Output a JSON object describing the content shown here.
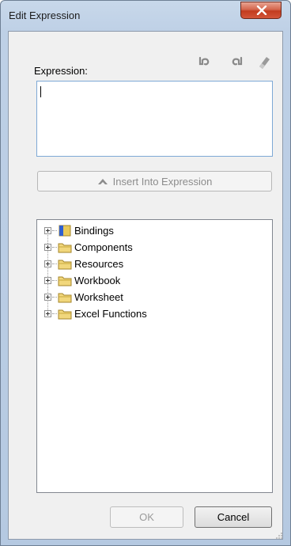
{
  "window": {
    "title": "Edit Expression"
  },
  "expression": {
    "label": "Expression:",
    "value": ""
  },
  "toolbar": {
    "undo_icon": "undo-icon",
    "redo_icon": "redo-icon",
    "clear_icon": "eraser-icon"
  },
  "insert_button": {
    "label": "Insert Into Expression"
  },
  "tree": {
    "items": [
      {
        "label": "Bindings",
        "icon": "bindings-folder-icon"
      },
      {
        "label": "Components",
        "icon": "folder-icon"
      },
      {
        "label": "Resources",
        "icon": "folder-icon"
      },
      {
        "label": "Workbook",
        "icon": "folder-icon"
      },
      {
        "label": "Worksheet",
        "icon": "folder-icon"
      },
      {
        "label": "Excel Functions",
        "icon": "folder-icon"
      }
    ]
  },
  "buttons": {
    "ok": "OK",
    "cancel": "Cancel"
  },
  "colors": {
    "titlebar": "#bed0e6",
    "close": "#c23c1f",
    "client": "#f0f0f0",
    "folder": "#e8c95a",
    "bindings_accent": "#2f5fd0"
  }
}
